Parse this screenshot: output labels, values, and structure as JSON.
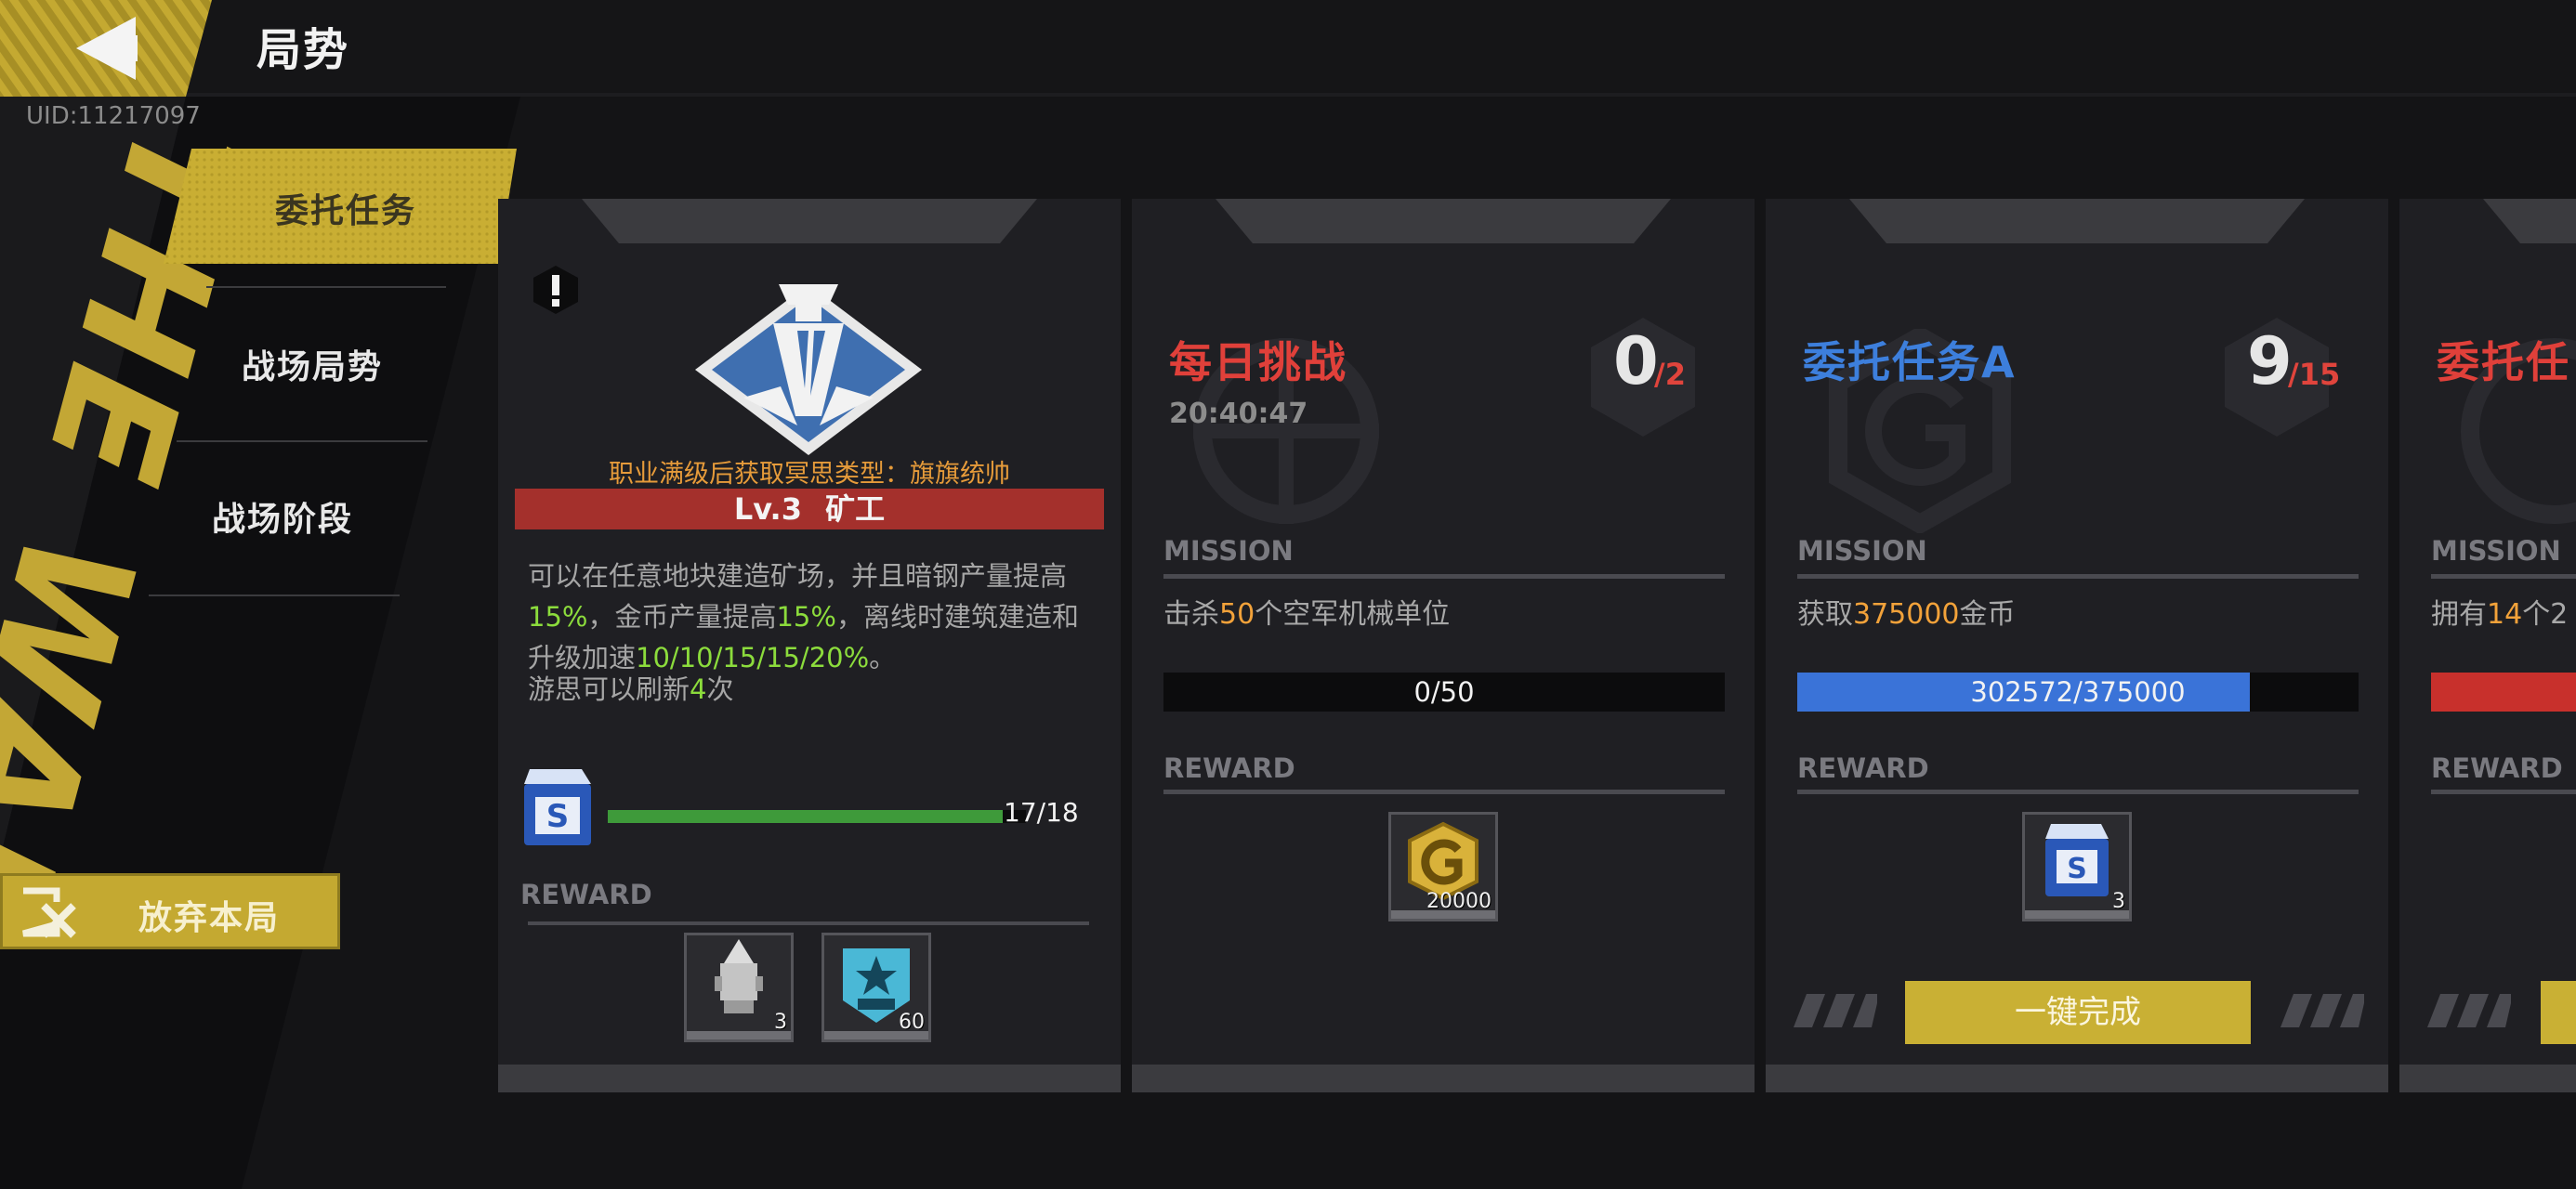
{
  "header": {
    "title": "局势",
    "uid": "UID:11217097"
  },
  "sidebar": {
    "deco_text": "THE WAR",
    "items": [
      {
        "label": "委托任务",
        "active": true
      },
      {
        "label": "战场局势",
        "active": false
      },
      {
        "label": "战场阶段",
        "active": false
      }
    ],
    "abandon_label": "放弃本局"
  },
  "profession_card": {
    "alert_icon": "exclamation-icon",
    "emblem_icon": "drill-diamond-icon",
    "unlock_note": "职业满级后获取冥思类型：旗旗统帅",
    "level": "Lv.3",
    "profession": "矿工",
    "desc": {
      "p1": "可以在任意地块建造矿场，并且暗钢产量提高",
      "v1": "15%",
      "p2": "，金币产量提高",
      "v2": "15%",
      "p3": "，离线时建筑建造和升级加速",
      "v3": "10/10/15/15/20%",
      "p4": "。",
      "p5": "游思可以刷新",
      "v4": "4",
      "p6": "次"
    },
    "exp_text": "17/18",
    "exp_fraction": 0.944,
    "reward_label": "REWARD",
    "rewards": [
      {
        "icon": "drill-item-icon",
        "count": "3"
      },
      {
        "icon": "star-badge-icon",
        "count": "60"
      }
    ]
  },
  "mission_cards": [
    {
      "title": "每日挑战",
      "title_color": "#e0403a",
      "timer": "20:40:47",
      "counter": {
        "current": "0",
        "total": "/2"
      },
      "mission_label": "MISSION",
      "mission_text": {
        "pre": "击杀",
        "value": "50",
        "post": "个空军机械单位"
      },
      "progress_text": "0/50",
      "progress_fraction": 0,
      "progress_color": "#3a73d8",
      "reward_label": "REWARD",
      "reward": {
        "icon": "gold-coin-icon",
        "count": "20000"
      }
    },
    {
      "title": "委托任务A",
      "title_color": "#3d7fdc",
      "counter": {
        "current": "9",
        "total": "/15"
      },
      "mission_label": "MISSION",
      "mission_text": {
        "pre": "获取",
        "value": "375000",
        "post": "金币"
      },
      "progress_text": "302572/375000",
      "progress_fraction": 0.807,
      "progress_color": "#3a73d8",
      "reward_label": "REWARD",
      "reward": {
        "icon": "supply-box-icon",
        "count": "3"
      },
      "button_label": "一键完成"
    },
    {
      "title": "委托任",
      "title_color": "#e0403a",
      "mission_label": "MISSION",
      "mission_text": {
        "pre": "拥有",
        "value": "14",
        "post": "个2"
      },
      "progress_fraction": 1,
      "progress_color": "#c8302c",
      "reward_label": "REWARD"
    }
  ],
  "colors": {
    "accent_gold": "#c4a931",
    "level_bar": "#a4302c",
    "exp_bar": "#3e9a3a"
  }
}
